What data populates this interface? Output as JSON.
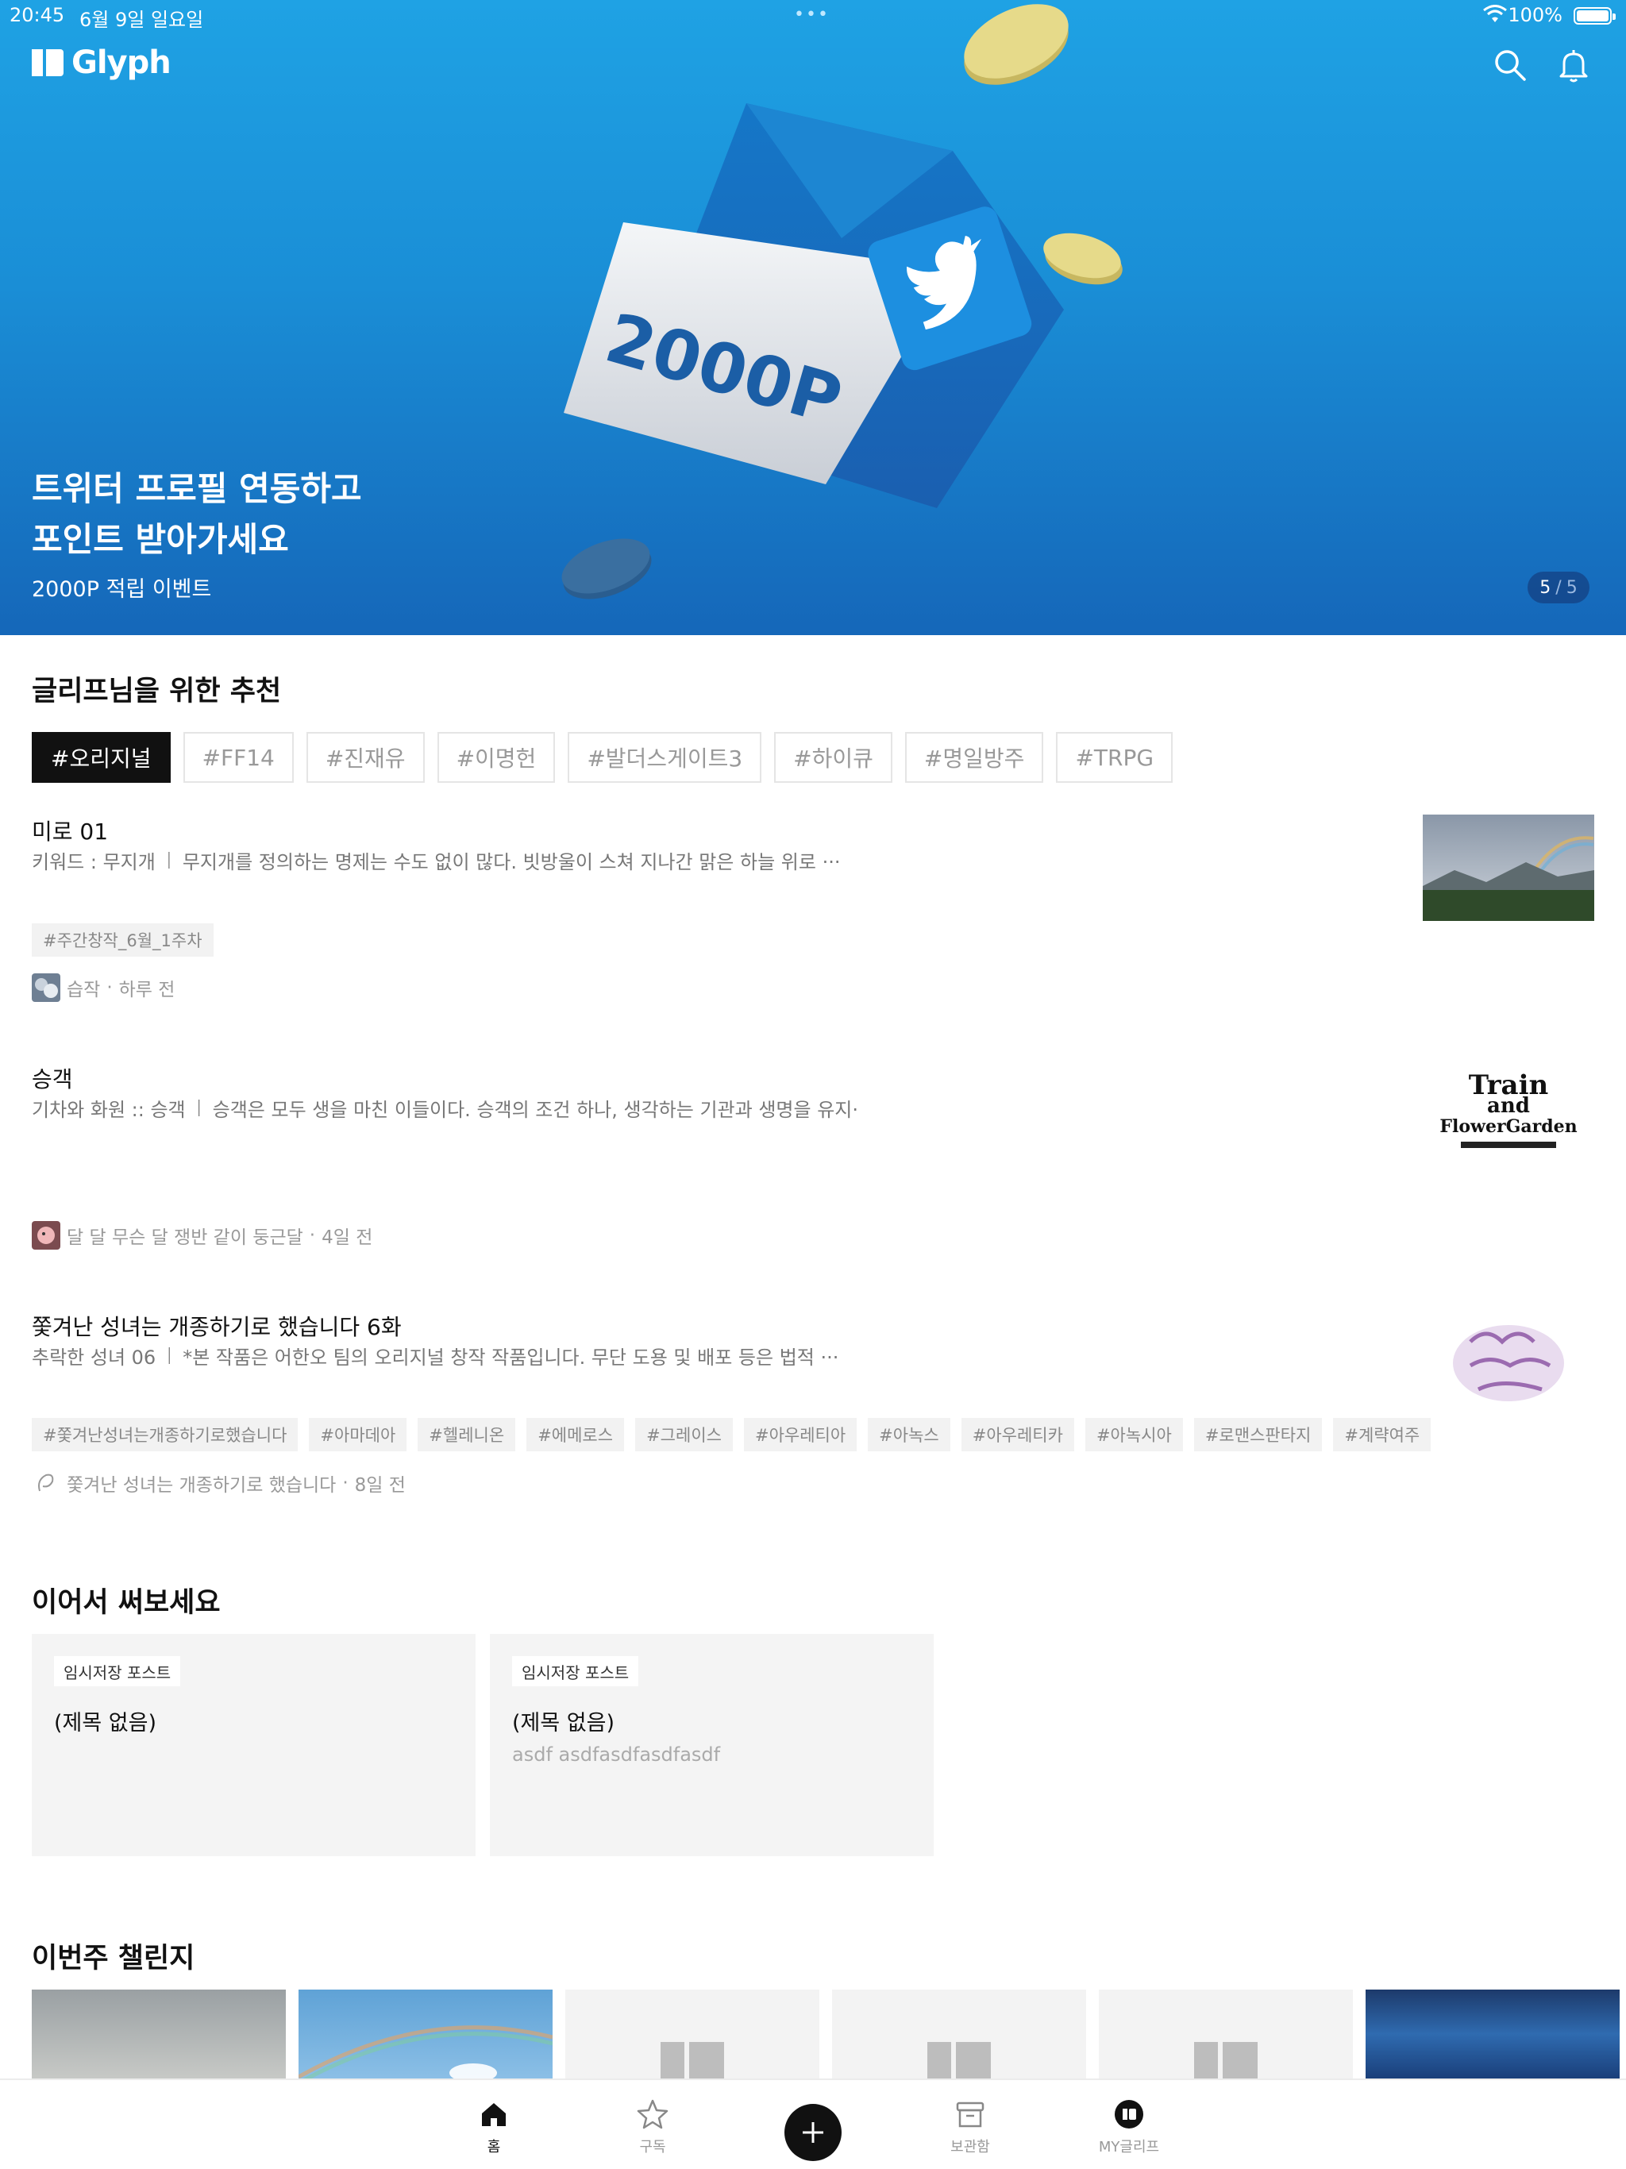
{
  "status": {
    "time": "20:45",
    "date": "6월 9일 일요일",
    "dots": "•••",
    "battery": "100%"
  },
  "app": {
    "name": "Glyph"
  },
  "hero": {
    "title_line1": "트위터 프로필 연동하고",
    "title_line2": "포인트 받아가세요",
    "subtitle": "2000P 적립 이벤트",
    "card_text": "2000P",
    "page_current": "5",
    "page_sep": "/",
    "page_total": "5"
  },
  "recommend": {
    "title": "글리프님을 위한 추천",
    "tags": [
      "#오리지널",
      "#FF14",
      "#진재유",
      "#이명헌",
      "#발더스게이트3",
      "#하이큐",
      "#명일방주",
      "#TRPG"
    ],
    "posts": [
      {
        "title": "미로 01",
        "excerpt": "키워드 : 무지개 ꒐ 무지개를 정의하는 명제는 수도 없이 많다. 빗방울이 스쳐 지나간 맑은 하늘 위로 ···",
        "tags": [
          "#주간창작_6월_1주차"
        ],
        "author": "습작",
        "time": "하루 전"
      },
      {
        "title": "승객",
        "excerpt": "기차와 화원 :: 승객 ꒐  승객은 모두 생을 마친 이들이다.  승객의 조건 하나, 생각하는 기관과 생명을 유지···",
        "tags": [],
        "author": "달 달 무슨 달 쟁반 같이 둥근달",
        "time": "4일 전",
        "thumb_line1": "Train",
        "thumb_line2": "and",
        "thumb_line3": "FlowerGarden"
      },
      {
        "title": "쫓겨난 성녀는 개종하기로 했습니다 6화",
        "excerpt": "추락한 성녀 06 ꒐ *본 작품은 어한오 팀의 오리지널 창작 작품입니다. 무단 도용 및 배포 등은 법적 ···",
        "tags": [
          "#쫓겨난성녀는개종하기로했습니다",
          "#아마데아",
          "#헬레니온",
          "#에메로스",
          "#그레이스",
          "#아우레티아",
          "#아녹스",
          "#아우레티카",
          "#아녹시아",
          "#로맨스판타지",
          "#계략여주"
        ],
        "author": "쫓겨난 성녀는 개종하기로 했습니다",
        "time": "8일 전"
      }
    ]
  },
  "continue": {
    "title": "이어서 써보세요",
    "drafts": [
      {
        "badge": "임시저장 포스트",
        "title": "(제목 없음)",
        "body": ""
      },
      {
        "badge": "임시저장 포스트",
        "title": "(제목 없음)",
        "body": "asdf asdfasdfasdfasdf"
      }
    ]
  },
  "challenge": {
    "title": "이번주 챌린지"
  },
  "tabbar": {
    "home": "홈",
    "subscribe": "구독",
    "storage": "보관함",
    "my": "MY글리프"
  },
  "colors": {
    "hero_top": "#1fa2e4",
    "hero_bottom": "#1567b9",
    "accent": "#111111"
  }
}
